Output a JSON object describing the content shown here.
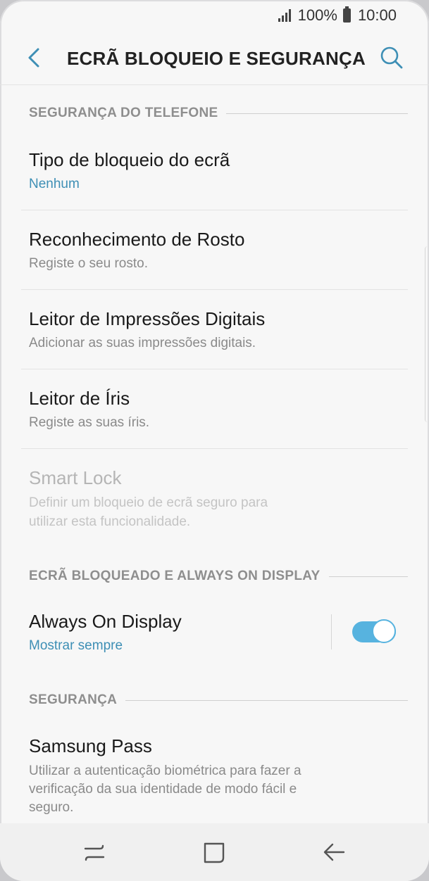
{
  "status_bar": {
    "battery": "100%",
    "time": "10:00"
  },
  "app_bar": {
    "title": "ECRÃ BLOQUEIO E SEGURANÇA"
  },
  "sections": {
    "phone_security": "SEGURANÇA DO TELEFONE",
    "lock_screen_aod": "ECRÃ BLOQUEADO E ALWAYS ON DISPLAY",
    "security": "SEGURANÇA"
  },
  "items": {
    "screen_lock_type": {
      "title": "Tipo de bloqueio do ecrã",
      "subtitle": "Nenhum"
    },
    "face_recognition": {
      "title": "Reconhecimento de Rosto",
      "subtitle": "Registe o seu rosto."
    },
    "fingerprint": {
      "title": "Leitor de Impressões Digitais",
      "subtitle": "Adicionar as suas impressões digitais."
    },
    "iris": {
      "title": "Leitor de Íris",
      "subtitle": "Registe as suas íris."
    },
    "smart_lock": {
      "title": "Smart Lock",
      "subtitle_line1": "Definir um bloqueio de ecrã seguro para",
      "subtitle_line2": "utilizar esta funcionalidade."
    },
    "always_on_display": {
      "title": "Always On Display",
      "subtitle": "Mostrar sempre",
      "toggle_on": true
    },
    "samsung_pass": {
      "title": "Samsung Pass",
      "subtitle_line1": "Utilizar a autenticação biométrica para fazer a",
      "subtitle_line2": "verificação da sua identidade de modo fácil e",
      "subtitle_line3": "seguro."
    }
  },
  "colors": {
    "accent": "#3e8fb5",
    "toggle": "#57b3df"
  },
  "icons": {
    "back": "back-arrow-icon",
    "search": "search-icon",
    "recents": "recent-apps-icon",
    "home": "home-icon",
    "nav_back": "nav-back-icon"
  }
}
